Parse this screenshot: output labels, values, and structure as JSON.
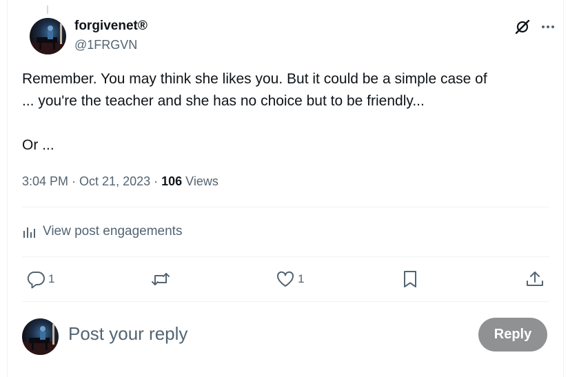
{
  "post": {
    "author": {
      "name": "forgivenet®",
      "handle": "@1FRGVN"
    },
    "body": {
      "line1": "Remember. You may think she likes you. But it could be a simple case of",
      "line2": "... you're the teacher and she has no choice but to be friendly...",
      "line3": "Or ..."
    },
    "meta": {
      "time": "3:04 PM",
      "separator1": " · ",
      "date": "Oct 21, 2023",
      "separator2": " · ",
      "views_count": "106",
      "views_label": " Views"
    },
    "engagements_label": "View post engagements",
    "actions": {
      "replies": "1",
      "likes": "1"
    }
  },
  "reply_composer": {
    "placeholder": "Post your reply",
    "button_label": "Reply"
  },
  "icons": {
    "grok": "grok-icon",
    "more": "more-horizontal-icon",
    "engagements": "bar-chart-icon",
    "reply": "speech-bubble-icon",
    "repost": "repost-arrows-icon",
    "like": "heart-icon",
    "bookmark": "bookmark-icon",
    "share": "share-upload-icon"
  },
  "colors": {
    "text_primary": "#0f1419",
    "text_secondary": "#536471",
    "divider": "#eff3f4",
    "reply_button_disabled": "#8f9193"
  }
}
